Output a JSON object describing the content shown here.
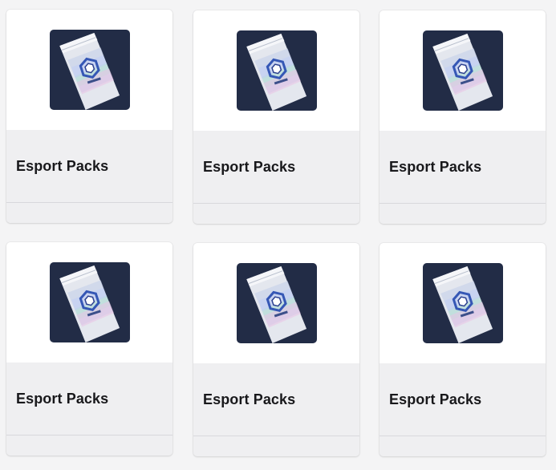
{
  "products": [
    {
      "title": "Esport Packs",
      "image_icon": "esport-pack-image"
    },
    {
      "title": "Esport Packs",
      "image_icon": "esport-pack-image"
    },
    {
      "title": "Esport Packs",
      "image_icon": "esport-pack-image"
    },
    {
      "title": "Esport Packs",
      "image_icon": "esport-pack-image"
    },
    {
      "title": "Esport Packs",
      "image_icon": "esport-pack-image"
    },
    {
      "title": "Esport Packs",
      "image_icon": "esport-pack-image"
    }
  ],
  "colors": {
    "page_background": "#f4f4f5",
    "card_body": "#efeff1",
    "image_background": "#ffffff",
    "title_text": "#18181b",
    "thumb_dark": "#1f2a44"
  }
}
